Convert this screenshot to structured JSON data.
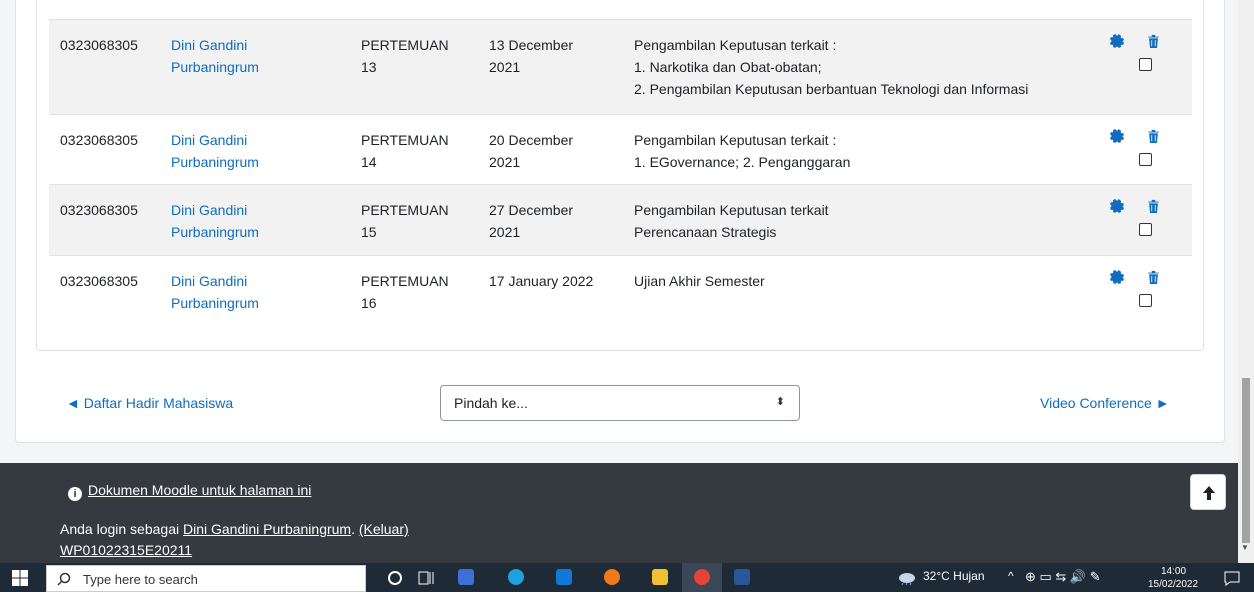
{
  "table": {
    "rows": [
      {
        "nim": "0323068305",
        "name": "Dini Gandini\nPurbaningrum",
        "meeting": "PERTEMUAN\n13",
        "date": "13 December\n2021",
        "topic": "Pengambilan Keputusan terkait :\n1. Narkotika dan Obat-obatan;\n2. Pengambilan Keputusan berbantuan Teknologi dan Informasi"
      },
      {
        "nim": "0323068305",
        "name": "Dini Gandini\nPurbaningrum",
        "meeting": "PERTEMUAN\n14",
        "date": "20 December\n2021",
        "topic": "Pengambilan Keputusan terkait :\n1. EGovernance; 2. Penganggaran"
      },
      {
        "nim": "0323068305",
        "name": "Dini Gandini\nPurbaningrum",
        "meeting": "PERTEMUAN\n15",
        "date": "27 December\n2021",
        "topic": "Pengambilan Keputusan terkait\nPerencanaan Strategis"
      },
      {
        "nim": "0323068305",
        "name": "Dini Gandini\nPurbaningrum",
        "meeting": "PERTEMUAN\n16",
        "date": "17 January 2022",
        "topic": "Ujian Akhir Semester"
      }
    ]
  },
  "nav": {
    "prev_label": "◄ Daftar Hadir Mahasiswa",
    "jump_placeholder": "Pindah ke...",
    "next_label": "Video Conference ►"
  },
  "footer": {
    "doc_link": "Dokumen Moodle untuk halaman ini",
    "login_prefix": "Anda login sebagai ",
    "login_user": "Dini Gandini Purbaningrum",
    "login_sep": ". ",
    "logout": "(Keluar)",
    "code": "WP01022315E20211"
  },
  "taskbar": {
    "search_placeholder": "Type here to search",
    "weather": "32°C  Hujan",
    "time": "14:00",
    "date": "15/02/2022"
  },
  "colors": {
    "link": "#0f6cbf",
    "footer_bg": "#343a40",
    "taskbar_bg": "#1f2a37"
  }
}
